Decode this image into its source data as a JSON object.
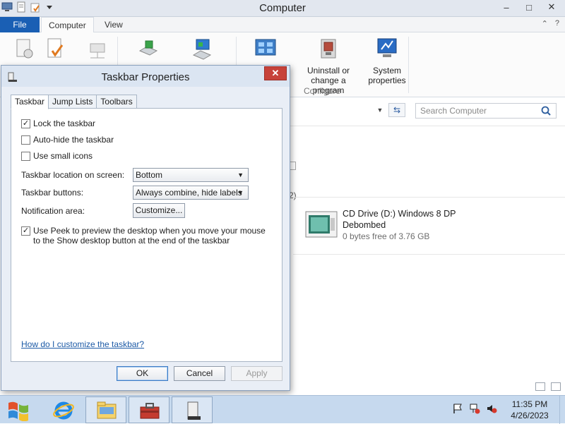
{
  "window": {
    "title": "Computer",
    "controls": {
      "minimize": "–",
      "maximize": "□",
      "close": "✕"
    }
  },
  "ribbon": {
    "tabs": {
      "file": "File",
      "computer": "Computer",
      "view": "View"
    },
    "buttons": {
      "uninstall_line1": "Uninstall or",
      "uninstall_line2": "change a program",
      "system_line1": "System",
      "system_line2": "properties"
    },
    "group_label": "Configure"
  },
  "search": {
    "placeholder": "Search Computer"
  },
  "content": {
    "fragment_text": "2)",
    "drive": {
      "name": "CD Drive (D:) Windows 8 DP",
      "label": "Debombed",
      "space": "0 bytes free of 3.76 GB"
    }
  },
  "dialog": {
    "title": "Taskbar Properties",
    "close_glyph": "✕",
    "tabs": [
      "Taskbar",
      "Jump Lists",
      "Toolbars"
    ],
    "options": {
      "lock": {
        "label": "Lock the taskbar",
        "checked": true
      },
      "autohide": {
        "label": "Auto-hide the taskbar",
        "checked": false
      },
      "small_icons": {
        "label": "Use small icons",
        "checked": false
      },
      "peek": {
        "label": "Use Peek to preview the desktop when you move your mouse to the Show desktop button at the end of the taskbar",
        "checked": true
      }
    },
    "location": {
      "label": "Taskbar location on screen:",
      "value": "Bottom"
    },
    "buttons_mode": {
      "label": "Taskbar buttons:",
      "value": "Always combine, hide labels"
    },
    "notification": {
      "label": "Notification area:",
      "button": "Customize..."
    },
    "help_link": "How do I customize the taskbar?",
    "ok": "OK",
    "cancel": "Cancel",
    "apply": "Apply"
  },
  "taskbar": {
    "time": "11:35 PM",
    "date": "4/26/2023"
  },
  "check_glyph": "✓",
  "colors": {
    "accent": "#1a5fb4",
    "taskbar": "#c6d9ee",
    "close_red": "#c7423a",
    "link": "#1c5aa6"
  }
}
